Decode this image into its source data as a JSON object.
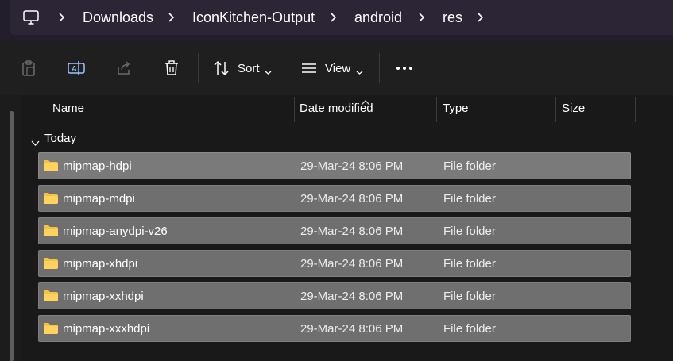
{
  "breadcrumb": {
    "root_icon": "computer-icon",
    "items": [
      {
        "label": "Downloads"
      },
      {
        "label": "IconKitchen-Output"
      },
      {
        "label": "android"
      },
      {
        "label": "res"
      }
    ]
  },
  "toolbar": {
    "paste_icon": "paste-icon",
    "rename_icon": "rename-icon",
    "share_icon": "share-icon",
    "delete_icon": "trash-icon",
    "sort_label": "Sort",
    "view_label": "View",
    "more_icon": "more-icon"
  },
  "columns": {
    "name": "Name",
    "date_modified": "Date modified",
    "type": "Type",
    "size": "Size"
  },
  "group": {
    "label": "Today"
  },
  "files": [
    {
      "name": "mipmap-hdpi",
      "date": "29-Mar-24 8:06 PM",
      "type": "File folder"
    },
    {
      "name": "mipmap-mdpi",
      "date": "29-Mar-24 8:06 PM",
      "type": "File folder"
    },
    {
      "name": "mipmap-anydpi-v26",
      "date": "29-Mar-24 8:06 PM",
      "type": "File folder"
    },
    {
      "name": "mipmap-xhdpi",
      "date": "29-Mar-24 8:06 PM",
      "type": "File folder"
    },
    {
      "name": "mipmap-xxhdpi",
      "date": "29-Mar-24 8:06 PM",
      "type": "File folder"
    },
    {
      "name": "mipmap-xxxhdpi",
      "date": "29-Mar-24 8:06 PM",
      "type": "File folder"
    }
  ],
  "colors": {
    "folder": "#f5c242",
    "row_selected": "#6f6f6f",
    "accent": "#9fc4ff"
  }
}
